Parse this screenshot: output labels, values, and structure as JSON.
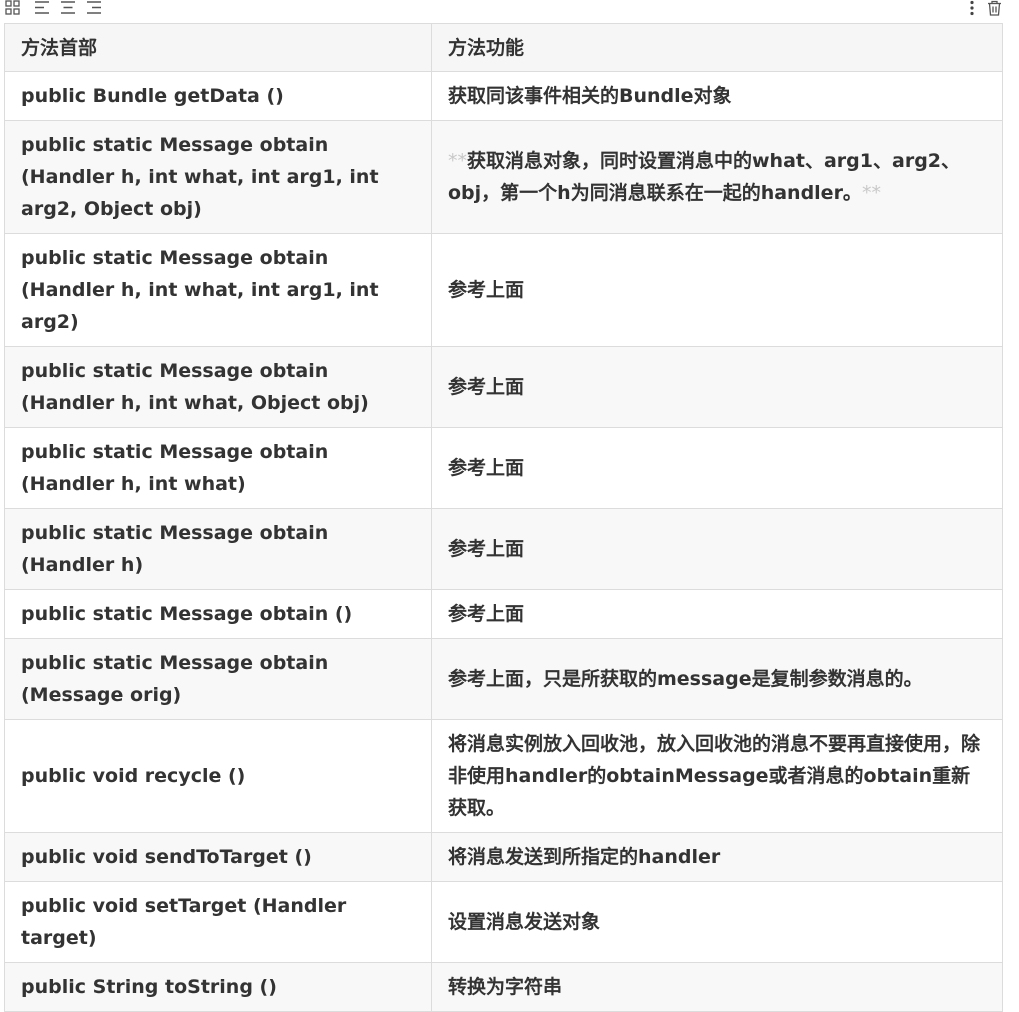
{
  "toolbar": {
    "icons": [
      "grid-icon",
      "align-left-icon",
      "align-center-icon",
      "align-right-icon",
      "more-vertical-icon",
      "trash-icon"
    ]
  },
  "table": {
    "headers": [
      "方法首部",
      "方法功能"
    ],
    "rows": [
      {
        "signature": "public Bundle getData ()",
        "description": "获取同该事件相关的Bundle对象"
      },
      {
        "signature": "public static Message obtain (Handler h, int what, int arg1, int arg2, Object obj)",
        "description_prefix": "**",
        "description": "获取消息对象，同时设置消息中的what、arg1、arg2、obj，第一个h为同消息联系在一起的handler。",
        "description_suffix": "**"
      },
      {
        "signature": "public static Message obtain (Handler h, int what, int arg1, int arg2)",
        "description": "参考上面"
      },
      {
        "signature": "public static Message obtain (Handler h, int what, Object obj)",
        "description": "参考上面"
      },
      {
        "signature": "public static Message obtain (Handler h, int what)",
        "description": "参考上面"
      },
      {
        "signature": "public static Message obtain (Handler h)",
        "description": "参考上面"
      },
      {
        "signature": "public static Message obtain ()",
        "description": "参考上面"
      },
      {
        "signature": "public static Message obtain (Message orig)",
        "description": "参考上面，只是所获取的message是复制参数消息的。"
      },
      {
        "signature": "public void recycle ()",
        "description": "将消息实例放入回收池，放入回收池的消息不要再直接使用，除非使用handler的obtainMessage或者消息的obtain重新获取。"
      },
      {
        "signature": "public void sendToTarget ()",
        "description": "将消息发送到所指定的handler"
      },
      {
        "signature": "public void setTarget (Handler target)",
        "description": "设置消息发送对象"
      },
      {
        "signature": "public String toString ()",
        "description": "转换为字符串"
      }
    ]
  }
}
